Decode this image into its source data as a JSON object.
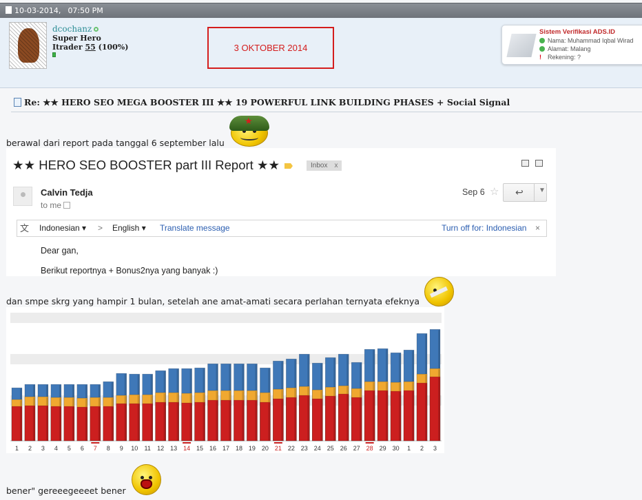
{
  "post_header": {
    "date": "10-03-2014,",
    "time": "07:50 PM"
  },
  "user": {
    "username": "dcochanz",
    "title": "Super Hero",
    "itrader_label": "Itrader",
    "itrader_count": "55",
    "itrader_pct": "(100%)"
  },
  "date_annotation": "3 OKTOBER 2014",
  "verification": {
    "title": "Sistem Verifikasi ADS.ID",
    "name": "Nama: Muhammad Iqbal Wirad",
    "address": "Alamat: Malang",
    "account": "Rekening: ?"
  },
  "post": {
    "title": "Re: ★★ HERO SEO MEGA BOOSTER III ★★ 19 POWERFUL LINK BUILDING PHASES + Social Signal",
    "text1": "berawal dari report pada tanggal 6 september lalu",
    "text2": "dan smpe skrg yang hampir 1 bulan, setelah ane amat-amati secara perlahan ternyata efeknya",
    "text3": "bener\" gereeegeeeet bener"
  },
  "email": {
    "subject": "★★ HERO SEO BOOSTER part III Report ★★",
    "label": "Inbox",
    "label_close": "x",
    "sender": "Calvin Tedja",
    "to": "to me",
    "date": "Sep 6",
    "translate": {
      "from": "Indonesian ▾",
      "arrow": ">",
      "to": "English ▾",
      "action": "Translate message",
      "turn_off": "Turn off for: Indonesian",
      "close": "×"
    },
    "body_line1": "Dear gan,",
    "body_line2": "Berikut reportnya + Bonus2nya yang banyak :)"
  },
  "chart_data": {
    "type": "bar",
    "categories": [
      "1",
      "2",
      "3",
      "4",
      "5",
      "6",
      "7",
      "8",
      "9",
      "10",
      "11",
      "12",
      "13",
      "14",
      "15",
      "16",
      "17",
      "18",
      "19",
      "20",
      "21",
      "22",
      "23",
      "24",
      "25",
      "26",
      "27",
      "28",
      "29",
      "30",
      "1",
      "2",
      "3"
    ],
    "highlighted_categories": [
      "7",
      "14",
      "21",
      "28"
    ],
    "series": [
      {
        "color": "#3f78b8",
        "values": [
          77,
          82,
          82,
          82,
          82,
          82,
          82,
          86,
          98,
          97,
          97,
          102,
          105,
          105,
          106,
          112,
          112,
          112,
          112,
          106,
          116,
          119,
          126,
          113,
          121,
          126,
          114,
          133,
          134,
          128,
          132,
          156,
          162
        ]
      },
      {
        "color": "#f0a830",
        "values": [
          60,
          64,
          64,
          63,
          63,
          62,
          63,
          63,
          66,
          67,
          67,
          70,
          70,
          69,
          70,
          73,
          73,
          73,
          73,
          70,
          75,
          77,
          79,
          74,
          78,
          80,
          76,
          86,
          86,
          85,
          86,
          97,
          105
        ]
      },
      {
        "color": "#cc1f1f",
        "values": [
          50,
          51,
          51,
          50,
          50,
          49,
          50,
          50,
          54,
          54,
          54,
          56,
          56,
          55,
          56,
          59,
          59,
          59,
          59,
          56,
          61,
          63,
          66,
          61,
          65,
          68,
          63,
          73,
          73,
          72,
          73,
          84,
          93
        ]
      }
    ]
  }
}
